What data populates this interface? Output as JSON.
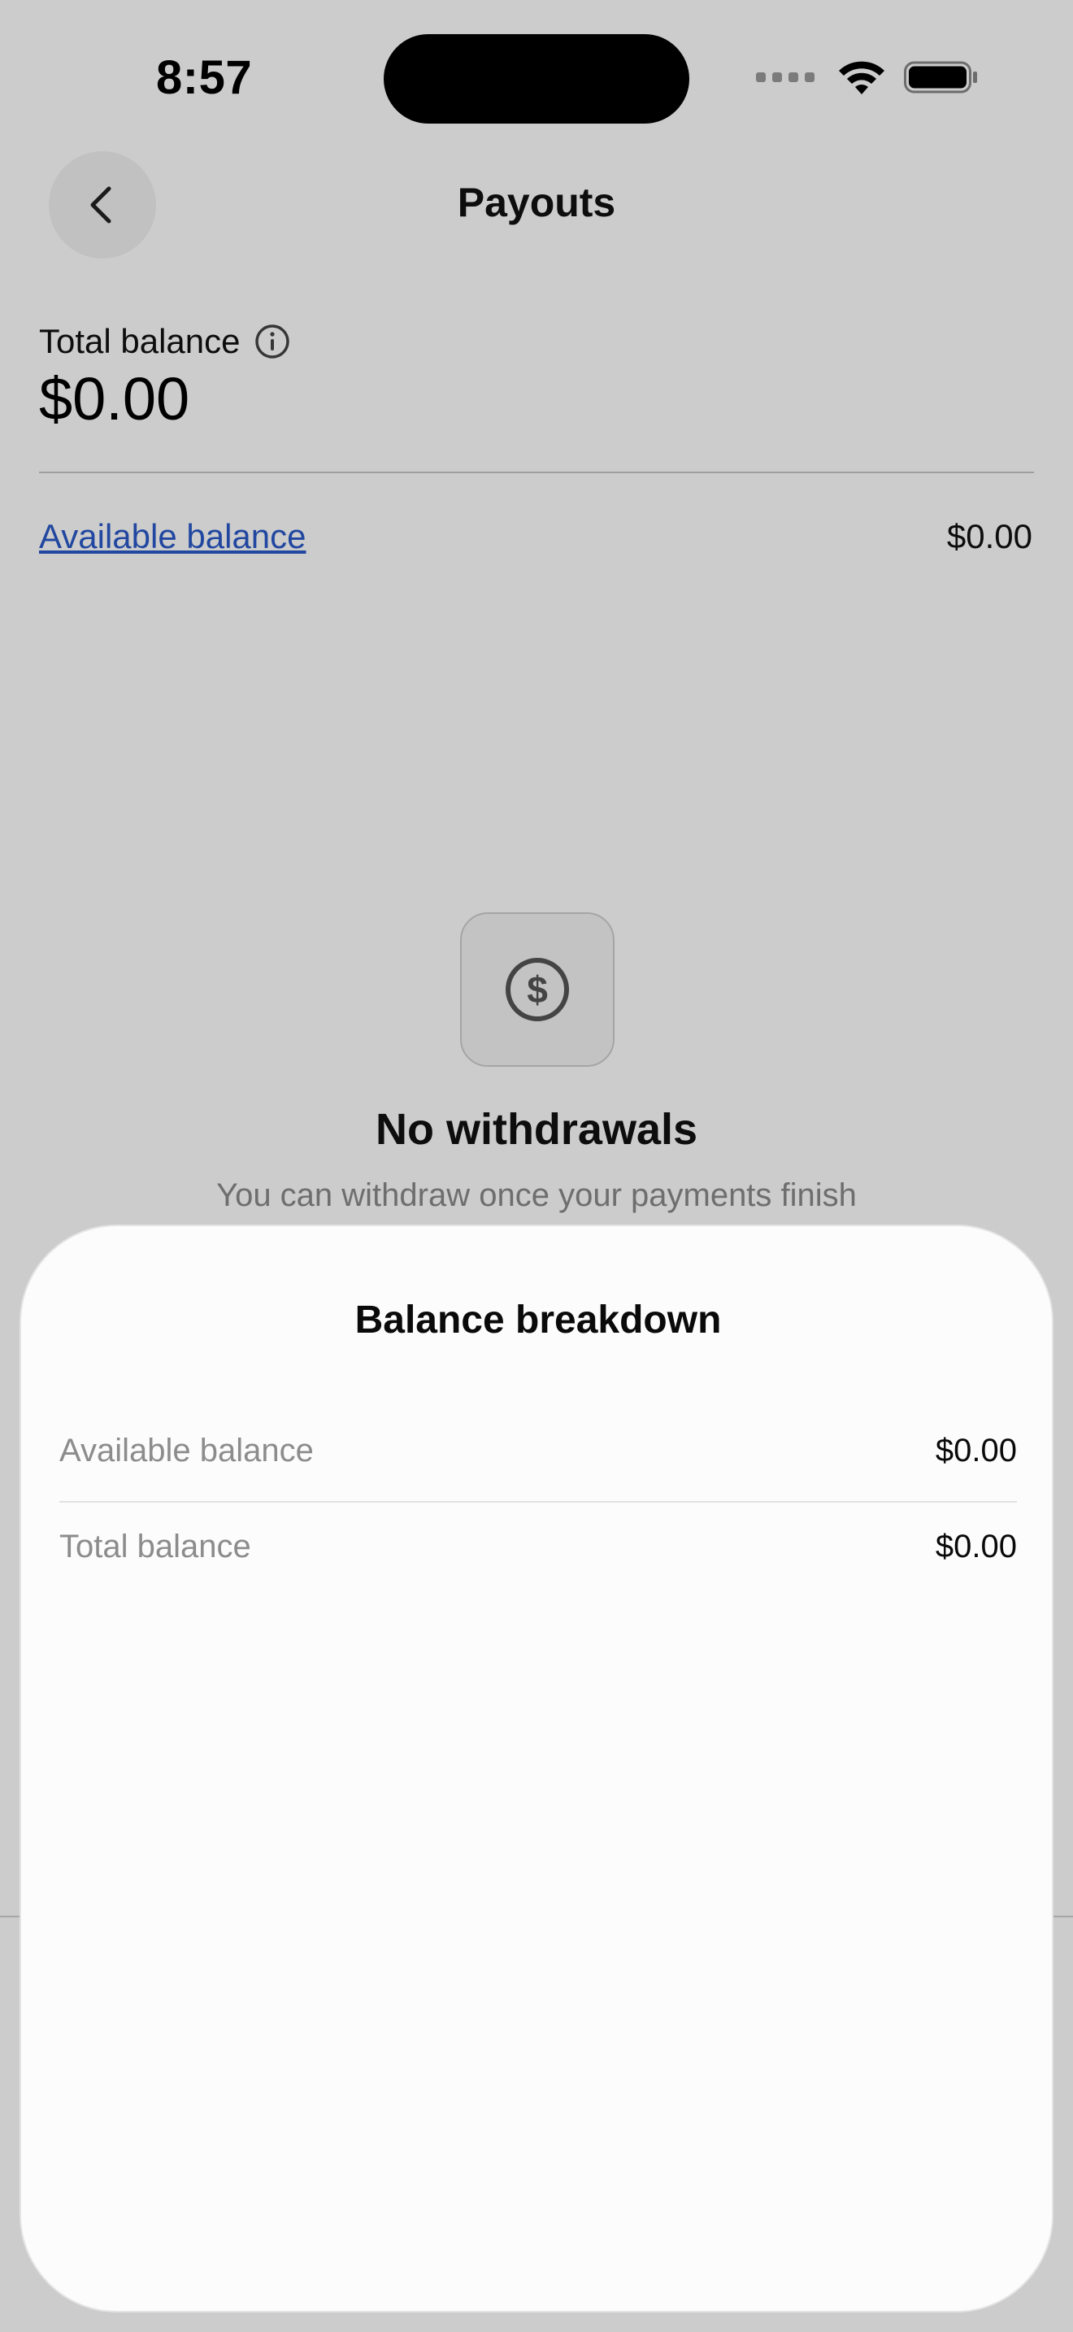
{
  "status_bar": {
    "time": "8:57",
    "icons": [
      "signal-icon",
      "wifi-icon",
      "battery-icon"
    ]
  },
  "nav": {
    "title": "Payouts",
    "back_icon": "chevron-left-icon"
  },
  "balance": {
    "label": "Total balance",
    "amount": "$0.00",
    "info_icon": "info-icon"
  },
  "available": {
    "link_label": "Available balance",
    "value": "$0.00"
  },
  "empty_state": {
    "icon": "dollar-circle-icon",
    "title": "No withdrawals",
    "subtitle": "You can withdraw once your payments finish"
  },
  "sheet": {
    "title": "Balance breakdown",
    "rows": [
      {
        "label": "Available balance",
        "value": "$0.00"
      },
      {
        "label": "Total balance",
        "value": "$0.00"
      }
    ]
  },
  "colors": {
    "link": "#2a59c9",
    "scrim": "rgba(0,0,0,0.2)",
    "sheet_background": "#fcfcfc"
  }
}
